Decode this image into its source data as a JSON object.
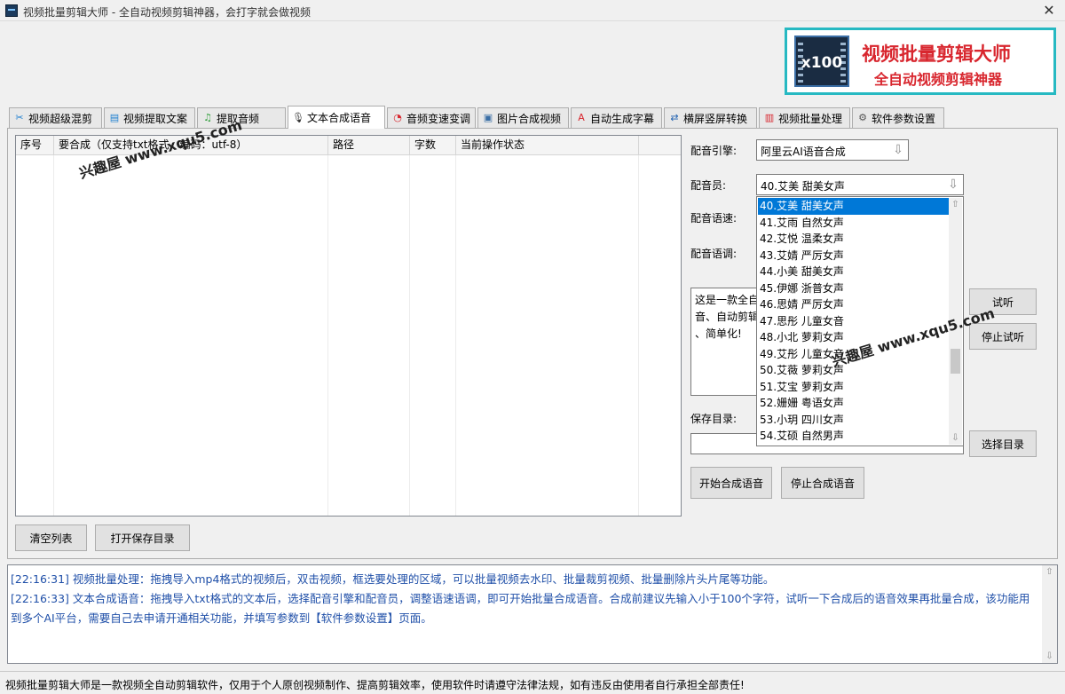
{
  "window": {
    "title": "视频批量剪辑大师 - 全自动视频剪辑神器，会打字就会做视频",
    "close_glyph": "✕"
  },
  "logo": {
    "badge": "x100",
    "title": "视频批量剪辑大师",
    "subtitle": "全自动视频剪辑神器"
  },
  "tabs": [
    {
      "label": "视频超级混剪",
      "icon": "scissors-icon",
      "glyph": "✂",
      "color": "#1e7fd0"
    },
    {
      "label": "视频提取文案",
      "icon": "document-icon",
      "glyph": "▤",
      "color": "#1e7fd0"
    },
    {
      "label": "提取音频",
      "icon": "audio-icon",
      "glyph": "♫",
      "color": "#2e9e3a"
    },
    {
      "label": "文本合成语音",
      "icon": "microphone-icon",
      "glyph": "🎙",
      "color": "#333333"
    },
    {
      "label": "音频变速变调",
      "icon": "gauge-icon",
      "glyph": "◔",
      "color": "#d8262e"
    },
    {
      "label": "图片合成视频",
      "icon": "picture-icon",
      "glyph": "▣",
      "color": "#3a6ea5"
    },
    {
      "label": "自动生成字幕",
      "icon": "font-icon",
      "glyph": "A",
      "color": "#d8262e"
    },
    {
      "label": "横屏竖屏转换",
      "icon": "rotate-icon",
      "glyph": "⇄",
      "color": "#1e5fb0"
    },
    {
      "label": "视频批量处理",
      "icon": "film-icon",
      "glyph": "▥",
      "color": "#d8262e"
    },
    {
      "label": "软件参数设置",
      "icon": "gear-icon",
      "glyph": "⚙",
      "color": "#555555"
    }
  ],
  "list": {
    "columns": [
      "序号",
      "要合成（仅支持txt格式，编码：utf-8）",
      "路径",
      "字数",
      "当前操作状态"
    ]
  },
  "buttons": {
    "clear_list": "清空列表",
    "open_save_dir": "打开保存目录",
    "preview": "试听",
    "stop_preview": "停止试听",
    "choose_dir": "选择目录",
    "start_synth": "开始合成语音",
    "stop_synth": "停止合成语音"
  },
  "settings": {
    "engine_label": "配音引擎:",
    "engine_value": "阿里云AI语音合成",
    "voice_label": "配音员:",
    "voice_value": "40.艾美 甜美女声",
    "speed_label": "配音语速:",
    "pitch_label": "配音语调:",
    "save_label": "保存目录:",
    "save_value": "",
    "text_preview": "这是一款全自\n音、自动剪辑\n、简单化!"
  },
  "voices": [
    "40.艾美 甜美女声",
    "41.艾雨 自然女声",
    "42.艾悦 温柔女声",
    "43.艾婧 严厉女声",
    "44.小美 甜美女声",
    "45.伊娜 浙普女声",
    "46.思婧 严厉女声",
    "47.思彤 儿童女音",
    "48.小北 萝莉女声",
    "49.艾彤 儿童女音",
    "50.艾薇 萝莉女声",
    "51.艾宝 萝莉女声",
    "52.姗姗 粤语女声",
    "53.小玥 四川女声",
    "54.艾硕 自然男声"
  ],
  "log": [
    "[22:16:31] 视频批量处理：拖拽导入mp4格式的视频后，双击视频，框选要处理的区域，可以批量视频去水印、批量裁剪视频、批量删除片头片尾等功能。",
    "[22:16:33] 文本合成语音：拖拽导入txt格式的文本后，选择配音引擎和配音员，调整语速语调，即可开始批量合成语音。合成前建议先输入小于100个字符，试听一下合成后的语音效果再批量合成，该功能用到多个AI平台，需要自己去申请开通相关功能，并填写参数到【软件参数设置】页面。"
  ],
  "status": "视频批量剪辑大师是一款视频全自动剪辑软件，仅用于个人原创视频制作、提高剪辑效率，使用软件时请遵守法律法规，如有违反由使用者自行承担全部责任!",
  "watermark": "兴趣屋 www.xqu5.com"
}
